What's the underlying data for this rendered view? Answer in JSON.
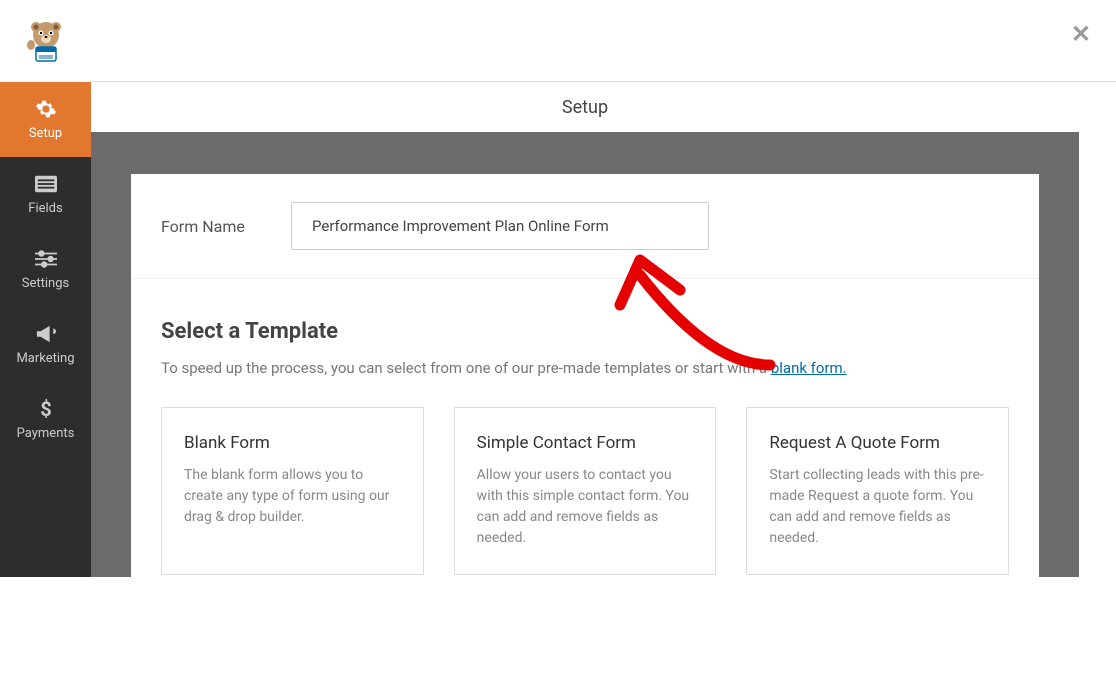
{
  "header": {
    "title": "Setup"
  },
  "sidebar": {
    "items": [
      {
        "label": "Setup"
      },
      {
        "label": "Fields"
      },
      {
        "label": "Settings"
      },
      {
        "label": "Marketing"
      },
      {
        "label": "Payments"
      }
    ]
  },
  "formName": {
    "label": "Form Name",
    "value": "Performance Improvement Plan Online Form"
  },
  "templates": {
    "heading": "Select a Template",
    "subtext_before": "To speed up the process, you can select from one of our pre-made templates or start with a ",
    "blank_link": "blank form.",
    "cards": [
      {
        "title": "Blank Form",
        "desc": "The blank form allows you to create any type of form using our drag & drop builder."
      },
      {
        "title": "Simple Contact Form",
        "desc": "Allow your users to contact you with this simple contact form. You can add and remove fields as needed."
      },
      {
        "title": "Request A Quote Form",
        "desc": "Start collecting leads with this pre-made Request a quote form. You can add and remove fields as needed."
      }
    ]
  },
  "close_label": "✕"
}
